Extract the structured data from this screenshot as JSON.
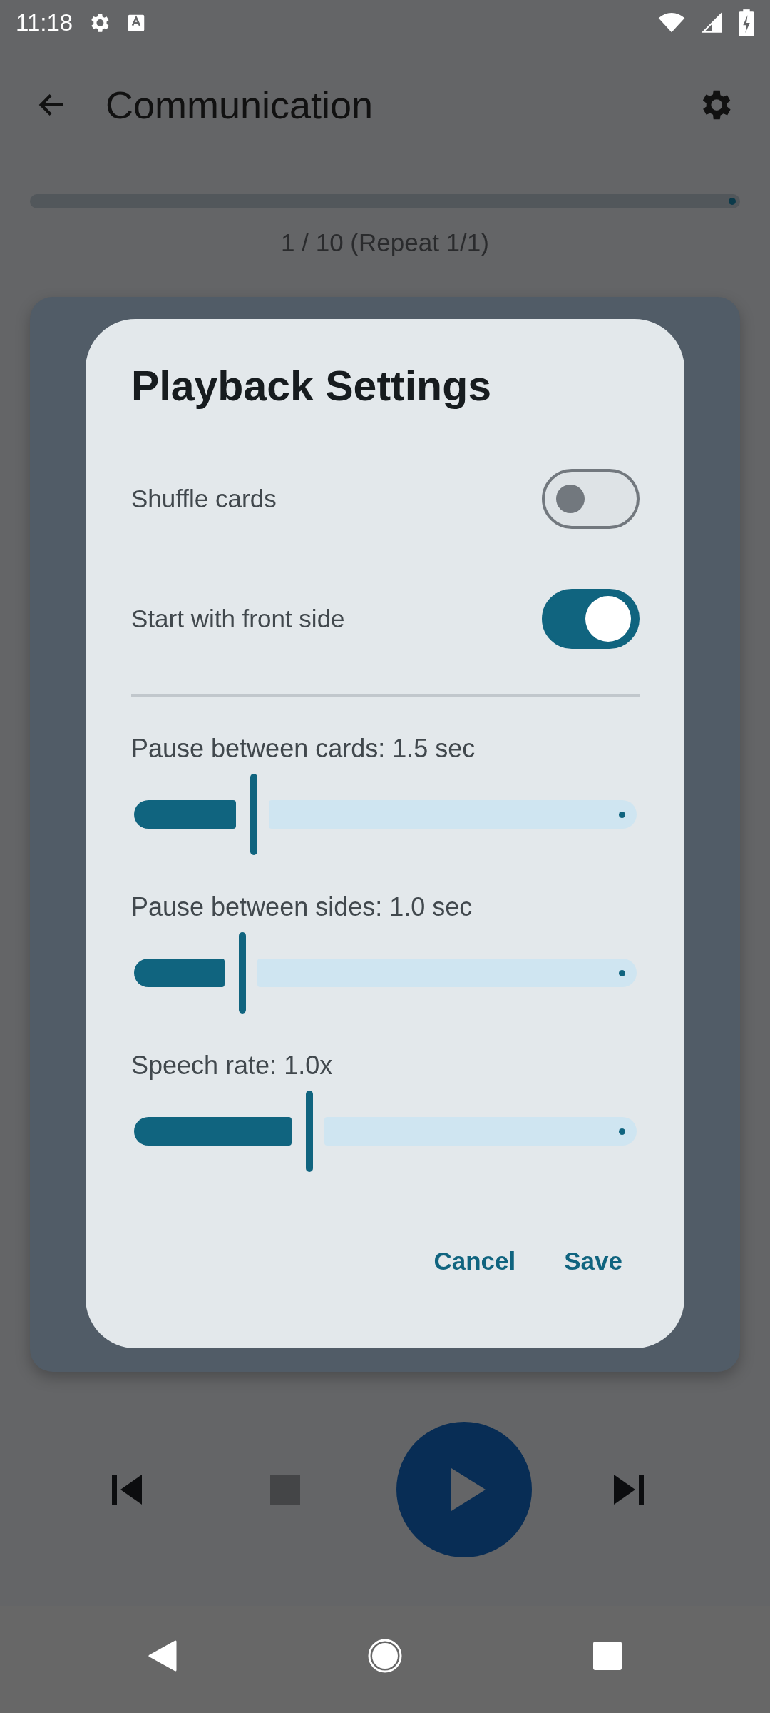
{
  "status_bar": {
    "time": "11:18"
  },
  "app_bar": {
    "title": "Communication"
  },
  "progress": {
    "level": 0,
    "counter": "1 / 10 (Repeat 1/1)"
  },
  "dialog": {
    "title": "Playback Settings",
    "toggles": [
      {
        "label": "Shuffle cards",
        "on": false
      },
      {
        "label": "Start with front side",
        "on": true
      }
    ],
    "sliders": [
      {
        "label": "Pause between cards: 1.5 sec",
        "level": 0.222
      },
      {
        "label": "Pause between sides: 1.0 sec",
        "level": 0.2
      },
      {
        "label": "Speech rate: 1.0x",
        "level": 0.333
      }
    ],
    "buttons": [
      {
        "label": "Cancel"
      },
      {
        "label": "Save"
      }
    ]
  }
}
